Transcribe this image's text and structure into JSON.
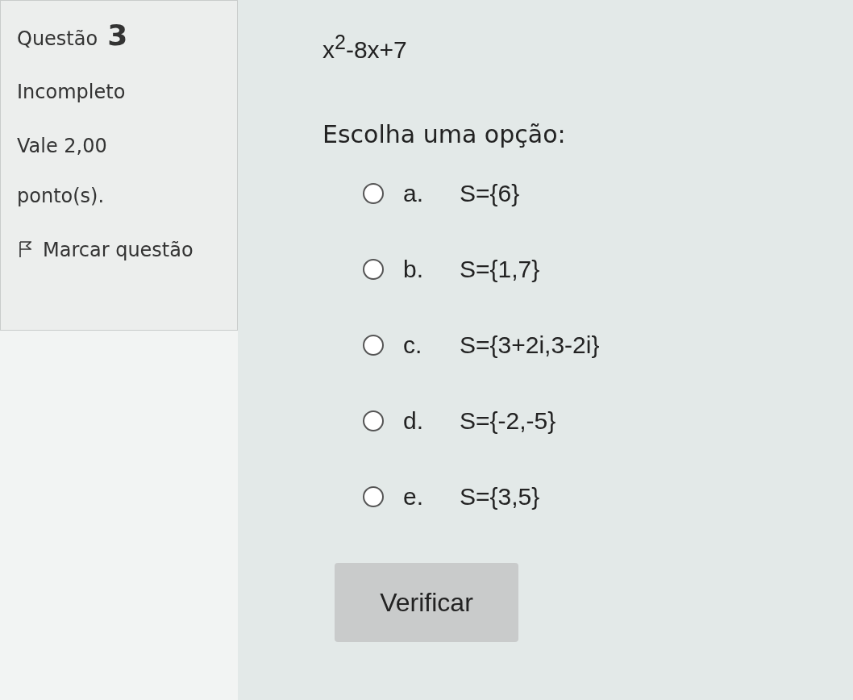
{
  "info": {
    "label": "Questão",
    "number": "3",
    "status": "Incompleto",
    "grade": "Vale 2,00 ponto(s).",
    "flag": "Marcar questão"
  },
  "question": {
    "expression": "x$^{2}$-8x+7",
    "instruction": "Escolha uma opção:"
  },
  "options": [
    {
      "letter": "a.",
      "text": "S={6}",
      "selected": false
    },
    {
      "letter": "b.",
      "text": "S={1,7}",
      "selected": false
    },
    {
      "letter": "c.",
      "text": "S={3+2i,3-2i}",
      "selected": false
    },
    {
      "letter": "d.",
      "text": "S={-2,-5}",
      "selected": false
    },
    {
      "letter": "e.",
      "text": "S={3,5}",
      "selected": false
    }
  ],
  "button": "Verificar"
}
